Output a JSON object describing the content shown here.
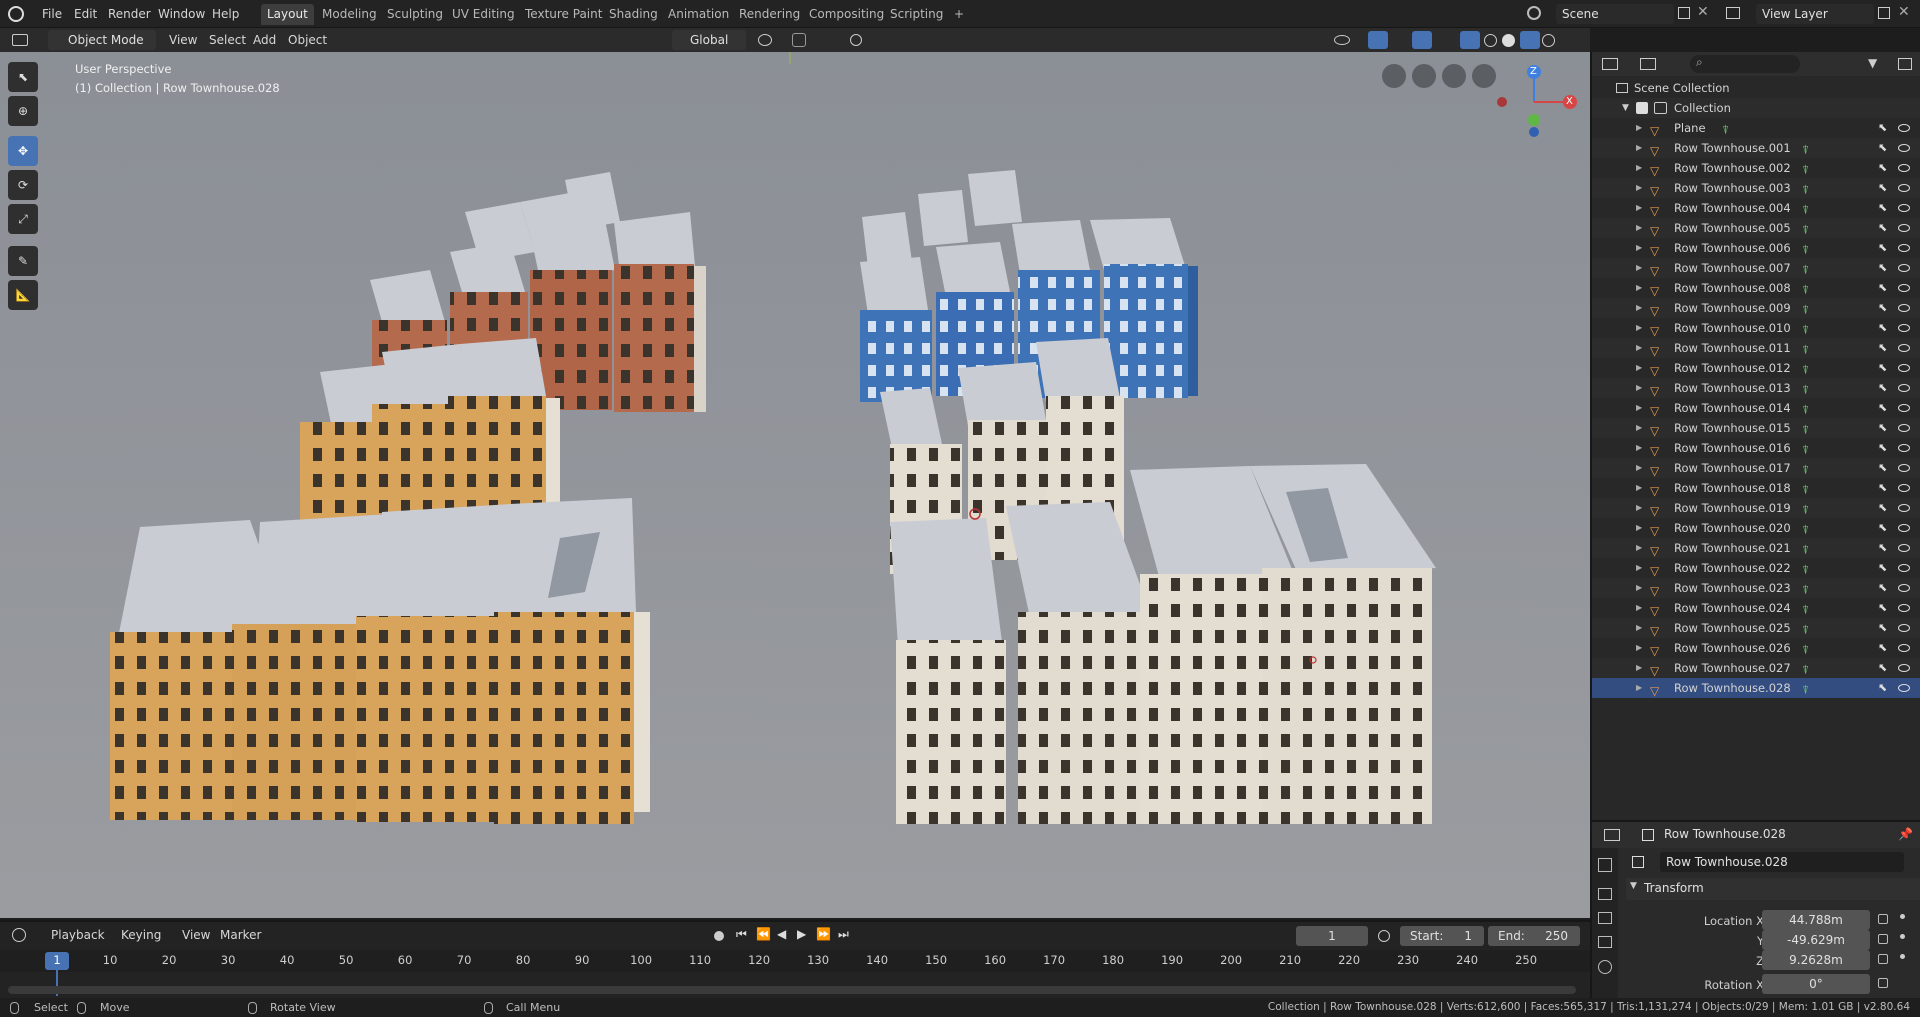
{
  "topbar": {
    "menus": [
      "File",
      "Edit",
      "Render",
      "Window",
      "Help"
    ],
    "workspaces": [
      "Layout",
      "Modeling",
      "Sculpting",
      "UV Editing",
      "Texture Paint",
      "Shading",
      "Animation",
      "Rendering",
      "Compositing",
      "Scripting"
    ],
    "active_workspace": "Layout",
    "add_tab": "+",
    "scene": "Scene",
    "view_layer": "View Layer"
  },
  "header": {
    "mode": "Object Mode",
    "view": "View",
    "select": "Select",
    "add": "Add",
    "object": "Object",
    "orientation": "Global"
  },
  "viewport": {
    "perspective": "User Perspective",
    "context": "(1) Collection | Row Townhouse.028",
    "gizmo_x": "X",
    "gizmo_z": "Z"
  },
  "outliner": {
    "search_placeholder": "",
    "scene_collection": "Scene Collection",
    "collection": "Collection",
    "objects": [
      "Plane",
      "Row Townhouse.001",
      "Row Townhouse.002",
      "Row Townhouse.003",
      "Row Townhouse.004",
      "Row Townhouse.005",
      "Row Townhouse.006",
      "Row Townhouse.007",
      "Row Townhouse.008",
      "Row Townhouse.009",
      "Row Townhouse.010",
      "Row Townhouse.011",
      "Row Townhouse.012",
      "Row Townhouse.013",
      "Row Townhouse.014",
      "Row Townhouse.015",
      "Row Townhouse.016",
      "Row Townhouse.017",
      "Row Townhouse.018",
      "Row Townhouse.019",
      "Row Townhouse.020",
      "Row Townhouse.021",
      "Row Townhouse.022",
      "Row Townhouse.023",
      "Row Townhouse.024",
      "Row Townhouse.025",
      "Row Townhouse.026",
      "Row Townhouse.027",
      "Row Townhouse.028"
    ],
    "selected": "Row Townhouse.028"
  },
  "properties": {
    "object_name": "Row Townhouse.028",
    "name_field": "Row Townhouse.028",
    "panel": "Transform",
    "location_x_label": "Location X",
    "location_x": "44.788m",
    "y_label": "Y",
    "location_y": "-49.629m",
    "z_label": "Z",
    "location_z": "9.2628m",
    "rotation_x_label": "Rotation X",
    "rotation_x": "0°"
  },
  "timeline": {
    "playback": "Playback",
    "keying": "Keying",
    "view": "View",
    "marker": "Marker",
    "current_frame": "1",
    "start_label": "Start:",
    "start": "1",
    "end_label": "End:",
    "end": "250",
    "ticks": [
      "1",
      "10",
      "20",
      "30",
      "40",
      "50",
      "60",
      "70",
      "80",
      "90",
      "100",
      "110",
      "120",
      "130",
      "140",
      "150",
      "160",
      "170",
      "180",
      "190",
      "200",
      "210",
      "220",
      "230",
      "240",
      "250"
    ]
  },
  "statusbar": {
    "select": "Select",
    "move": "Move",
    "rotate": "Rotate View",
    "call_menu": "Call Menu",
    "stats": "Collection | Row Townhouse.028 | Verts:612,600 | Faces:565,317 | Tris:1,131,274 | Objects:0/29 | Mem: 1.01 GB | v2.80.64"
  },
  "colors": {
    "accent": "#4772b3",
    "orange_building": "#d8a35a",
    "brick_building": "#b46a4c",
    "blue_building": "#3f73b8",
    "white_building": "#e3ddd2",
    "mesh_icon": "#6dc36d",
    "object_icon": "#e39a4e"
  }
}
